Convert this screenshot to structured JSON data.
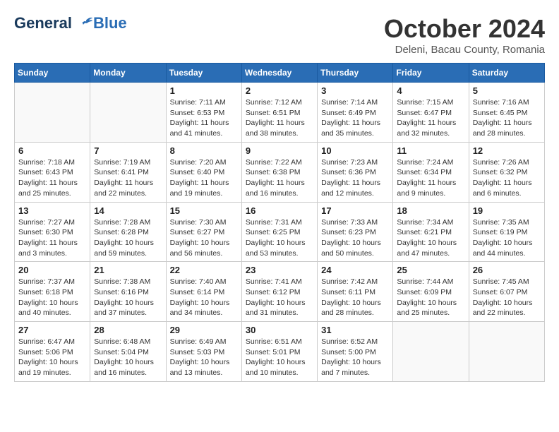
{
  "header": {
    "logo_general": "General",
    "logo_blue": "Blue",
    "month": "October 2024",
    "location": "Deleni, Bacau County, Romania"
  },
  "days_of_week": [
    "Sunday",
    "Monday",
    "Tuesday",
    "Wednesday",
    "Thursday",
    "Friday",
    "Saturday"
  ],
  "weeks": [
    [
      {
        "day": "",
        "info": ""
      },
      {
        "day": "",
        "info": ""
      },
      {
        "day": "1",
        "info": "Sunrise: 7:11 AM\nSunset: 6:53 PM\nDaylight: 11 hours and 41 minutes."
      },
      {
        "day": "2",
        "info": "Sunrise: 7:12 AM\nSunset: 6:51 PM\nDaylight: 11 hours and 38 minutes."
      },
      {
        "day": "3",
        "info": "Sunrise: 7:14 AM\nSunset: 6:49 PM\nDaylight: 11 hours and 35 minutes."
      },
      {
        "day": "4",
        "info": "Sunrise: 7:15 AM\nSunset: 6:47 PM\nDaylight: 11 hours and 32 minutes."
      },
      {
        "day": "5",
        "info": "Sunrise: 7:16 AM\nSunset: 6:45 PM\nDaylight: 11 hours and 28 minutes."
      }
    ],
    [
      {
        "day": "6",
        "info": "Sunrise: 7:18 AM\nSunset: 6:43 PM\nDaylight: 11 hours and 25 minutes."
      },
      {
        "day": "7",
        "info": "Sunrise: 7:19 AM\nSunset: 6:41 PM\nDaylight: 11 hours and 22 minutes."
      },
      {
        "day": "8",
        "info": "Sunrise: 7:20 AM\nSunset: 6:40 PM\nDaylight: 11 hours and 19 minutes."
      },
      {
        "day": "9",
        "info": "Sunrise: 7:22 AM\nSunset: 6:38 PM\nDaylight: 11 hours and 16 minutes."
      },
      {
        "day": "10",
        "info": "Sunrise: 7:23 AM\nSunset: 6:36 PM\nDaylight: 11 hours and 12 minutes."
      },
      {
        "day": "11",
        "info": "Sunrise: 7:24 AM\nSunset: 6:34 PM\nDaylight: 11 hours and 9 minutes."
      },
      {
        "day": "12",
        "info": "Sunrise: 7:26 AM\nSunset: 6:32 PM\nDaylight: 11 hours and 6 minutes."
      }
    ],
    [
      {
        "day": "13",
        "info": "Sunrise: 7:27 AM\nSunset: 6:30 PM\nDaylight: 11 hours and 3 minutes."
      },
      {
        "day": "14",
        "info": "Sunrise: 7:28 AM\nSunset: 6:28 PM\nDaylight: 10 hours and 59 minutes."
      },
      {
        "day": "15",
        "info": "Sunrise: 7:30 AM\nSunset: 6:27 PM\nDaylight: 10 hours and 56 minutes."
      },
      {
        "day": "16",
        "info": "Sunrise: 7:31 AM\nSunset: 6:25 PM\nDaylight: 10 hours and 53 minutes."
      },
      {
        "day": "17",
        "info": "Sunrise: 7:33 AM\nSunset: 6:23 PM\nDaylight: 10 hours and 50 minutes."
      },
      {
        "day": "18",
        "info": "Sunrise: 7:34 AM\nSunset: 6:21 PM\nDaylight: 10 hours and 47 minutes."
      },
      {
        "day": "19",
        "info": "Sunrise: 7:35 AM\nSunset: 6:19 PM\nDaylight: 10 hours and 44 minutes."
      }
    ],
    [
      {
        "day": "20",
        "info": "Sunrise: 7:37 AM\nSunset: 6:18 PM\nDaylight: 10 hours and 40 minutes."
      },
      {
        "day": "21",
        "info": "Sunrise: 7:38 AM\nSunset: 6:16 PM\nDaylight: 10 hours and 37 minutes."
      },
      {
        "day": "22",
        "info": "Sunrise: 7:40 AM\nSunset: 6:14 PM\nDaylight: 10 hours and 34 minutes."
      },
      {
        "day": "23",
        "info": "Sunrise: 7:41 AM\nSunset: 6:12 PM\nDaylight: 10 hours and 31 minutes."
      },
      {
        "day": "24",
        "info": "Sunrise: 7:42 AM\nSunset: 6:11 PM\nDaylight: 10 hours and 28 minutes."
      },
      {
        "day": "25",
        "info": "Sunrise: 7:44 AM\nSunset: 6:09 PM\nDaylight: 10 hours and 25 minutes."
      },
      {
        "day": "26",
        "info": "Sunrise: 7:45 AM\nSunset: 6:07 PM\nDaylight: 10 hours and 22 minutes."
      }
    ],
    [
      {
        "day": "27",
        "info": "Sunrise: 6:47 AM\nSunset: 5:06 PM\nDaylight: 10 hours and 19 minutes."
      },
      {
        "day": "28",
        "info": "Sunrise: 6:48 AM\nSunset: 5:04 PM\nDaylight: 10 hours and 16 minutes."
      },
      {
        "day": "29",
        "info": "Sunrise: 6:49 AM\nSunset: 5:03 PM\nDaylight: 10 hours and 13 minutes."
      },
      {
        "day": "30",
        "info": "Sunrise: 6:51 AM\nSunset: 5:01 PM\nDaylight: 10 hours and 10 minutes."
      },
      {
        "day": "31",
        "info": "Sunrise: 6:52 AM\nSunset: 5:00 PM\nDaylight: 10 hours and 7 minutes."
      },
      {
        "day": "",
        "info": ""
      },
      {
        "day": "",
        "info": ""
      }
    ]
  ]
}
